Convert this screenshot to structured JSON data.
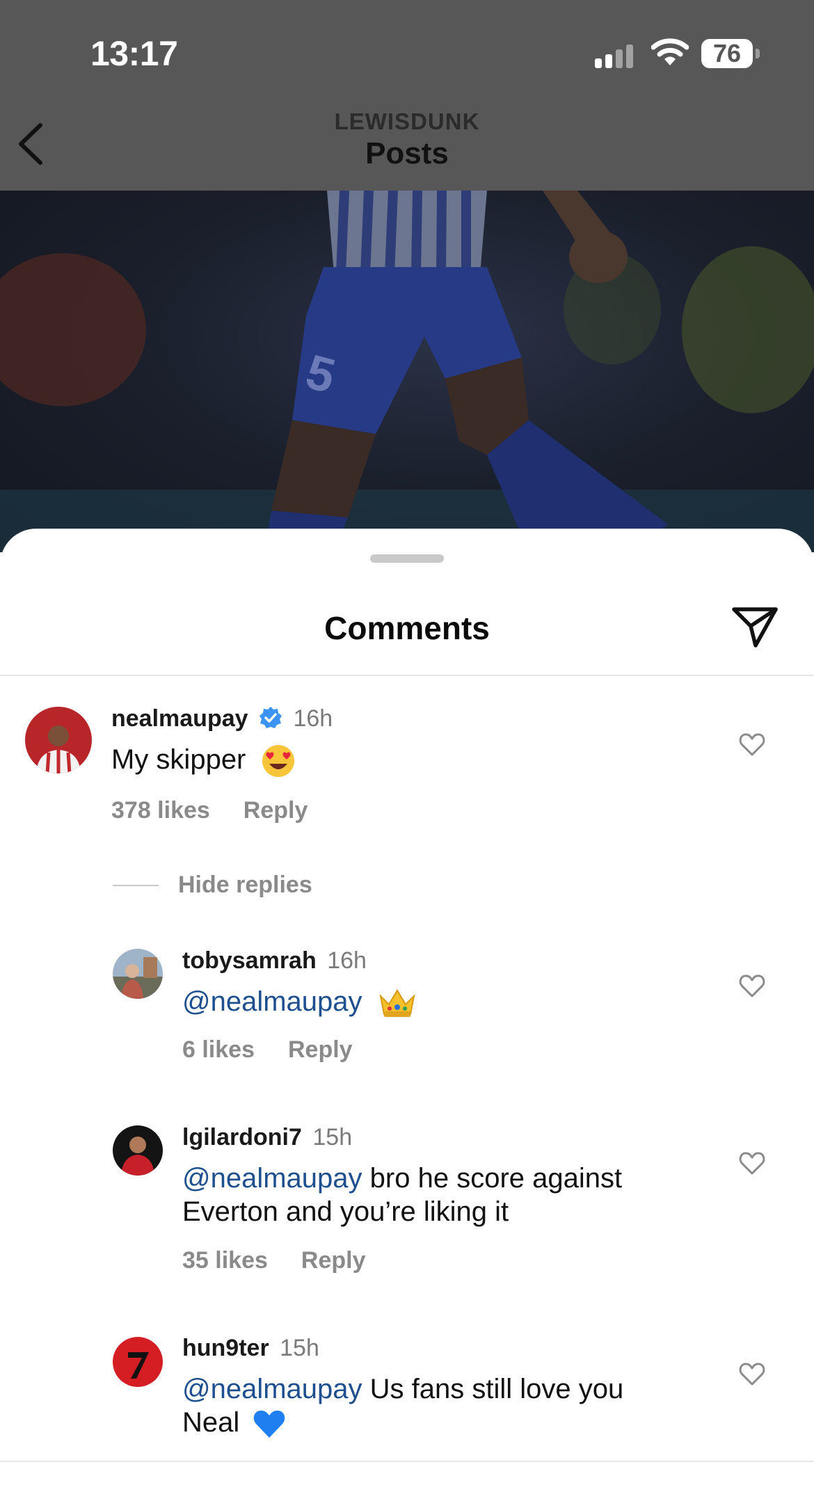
{
  "status": {
    "time": "13:17",
    "battery": "76"
  },
  "nav": {
    "username": "LEWISDUNK",
    "title": "Posts"
  },
  "sheet": {
    "title": "Comments"
  },
  "comments": [
    {
      "username": "nealmaupay",
      "verified": true,
      "time": "16h",
      "text": "My skipper",
      "emoji": "heart-eyes",
      "likes": "378 likes",
      "reply": "Reply"
    }
  ],
  "hide_replies": "Hide replies",
  "replies": [
    {
      "username": "tobysamrah",
      "time": "16h",
      "mention": "@nealmaupay",
      "text": "",
      "emoji": "crown",
      "likes": "6 likes",
      "reply": "Reply"
    },
    {
      "username": "lgilardoni7",
      "time": "15h",
      "mention": "@nealmaupay",
      "text": " bro he score against",
      "text2": "Everton and you’re liking it",
      "likes": "35 likes",
      "reply": "Reply"
    },
    {
      "username": "hun9ter",
      "time": "15h",
      "mention": "@nealmaupay",
      "text": " Us fans still love you",
      "text2": "Neal",
      "emoji": "blue-heart"
    }
  ],
  "colors": {
    "mention": "#1e4f8f",
    "verified": "#3b93f3",
    "dim_overlay": "#575757"
  }
}
